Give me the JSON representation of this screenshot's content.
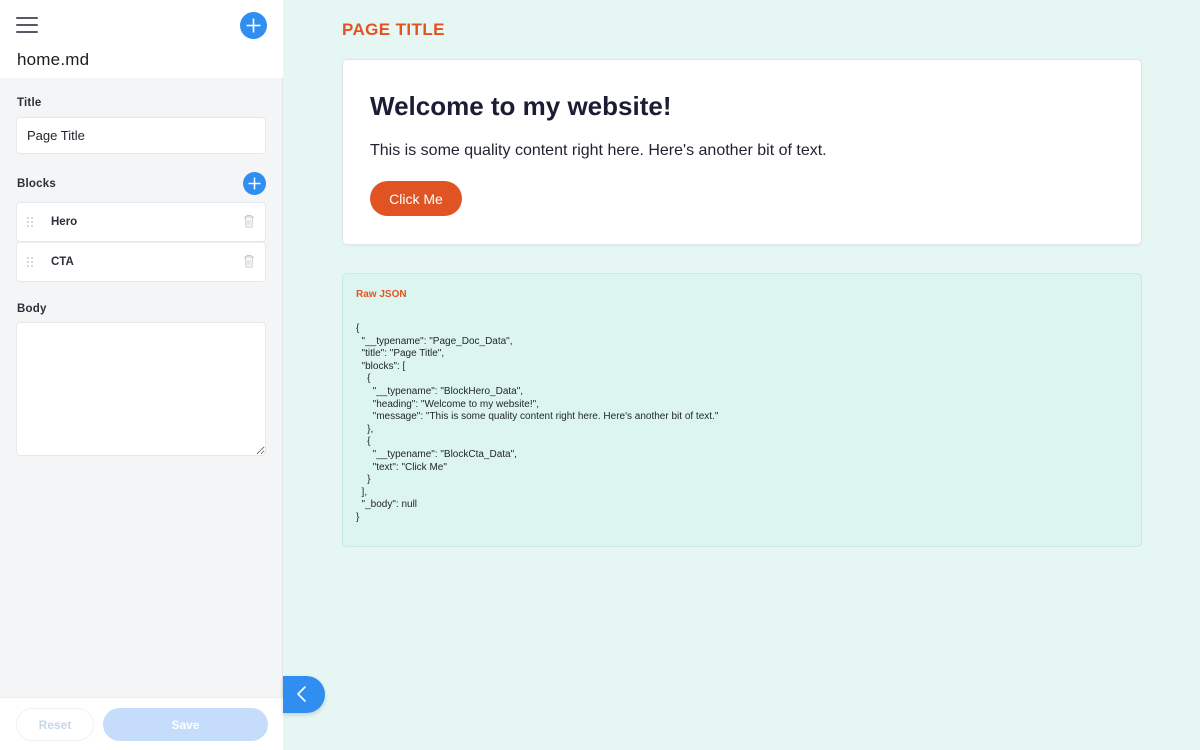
{
  "sidebar": {
    "filename": "home.md",
    "fields": {
      "title_label": "Title",
      "title_value": "Page Title",
      "blocks_label": "Blocks",
      "body_label": "Body",
      "body_value": ""
    },
    "blocks": [
      {
        "label": "Hero"
      },
      {
        "label": "CTA"
      }
    ],
    "footer": {
      "reset_label": "Reset",
      "save_label": "Save"
    }
  },
  "preview": {
    "page_title": "PAGE TITLE",
    "hero": {
      "heading": "Welcome to my website!",
      "message": "This is some quality content right here. Here's another bit of text."
    },
    "cta": {
      "text": "Click Me"
    },
    "raw_json": {
      "label": "Raw JSON",
      "content": "{\n  \"__typename\": \"Page_Doc_Data\",\n  \"title\": \"Page Title\",\n  \"blocks\": [\n    {\n      \"__typename\": \"BlockHero_Data\",\n      \"heading\": \"Welcome to my website!\",\n      \"message\": \"This is some quality content right here. Here's another bit of text.\"\n    },\n    {\n      \"__typename\": \"BlockCta_Data\",\n      \"text\": \"Click Me\"\n    }\n  ],\n  \"_body\": null\n}"
    }
  },
  "colors": {
    "accent_blue": "#2f8ef0",
    "accent_orange": "#e05424",
    "preview_bg": "#e6f6f3",
    "json_bg": "#dcf6ef"
  },
  "icons": {
    "menu": "hamburger-menu-icon",
    "add": "plus-icon",
    "drag": "drag-handle-icon",
    "delete": "trash-icon",
    "collapse": "chevron-left-icon"
  }
}
